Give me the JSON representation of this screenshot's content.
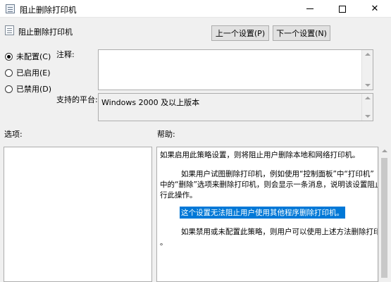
{
  "window": {
    "title": "阻止删除打印机",
    "icon": "policy-icon",
    "controls": {
      "minimize": "—",
      "close": "✕"
    }
  },
  "header": {
    "policy_name": "阻止删除打印机",
    "prev_button": "上一个设置(P)",
    "next_button": "下一个设置(N)"
  },
  "options": {
    "not_configured": "未配置(C)",
    "enabled": "已启用(E)",
    "disabled": "已禁用(D)",
    "selected": "not_configured"
  },
  "labels": {
    "comment": "注释:",
    "supported_on": "支持的平台:",
    "options_title": "选项:",
    "help_title": "帮助:"
  },
  "comment_value": "",
  "supported_value": "Windows 2000 及以上版本",
  "help": {
    "line1": "如果启用此策略设置，则将阻止用户删除本地和网络打印机。",
    "line2": "如果用户试图删除打印机，例如使用“控制面板”中“打印机”",
    "line3": "中的“删除”选项来删除打印机，则会显示一条消息，说明该设置阻止执",
    "line4": "行此操作。",
    "line5": "这个设置无法阻止用户使用其他程序删除打印机。",
    "line6": "如果禁用或未配置此策略，则用户可以使用上述方法删除打印机",
    "line7": "。"
  }
}
